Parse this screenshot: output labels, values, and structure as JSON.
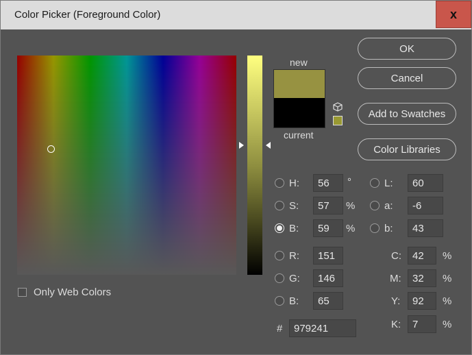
{
  "window": {
    "title": "Color Picker (Foreground Color)",
    "close_label": "x"
  },
  "swatches": {
    "new_label": "new",
    "current_label": "current",
    "new_color": "#979241",
    "current_color": "#000000",
    "websafe_color": "#999933"
  },
  "buttons": {
    "ok": "OK",
    "cancel": "Cancel",
    "add_to_swatches": "Add to Swatches",
    "color_libraries": "Color Libraries"
  },
  "only_web_colors": {
    "label": "Only Web Colors",
    "checked": false
  },
  "fields": {
    "H": {
      "label": "H:",
      "value": "56",
      "unit": "°"
    },
    "S": {
      "label": "S:",
      "value": "57",
      "unit": "%"
    },
    "Bv": {
      "label": "B:",
      "value": "59",
      "unit": "%"
    },
    "R": {
      "label": "R:",
      "value": "151"
    },
    "G": {
      "label": "G:",
      "value": "146"
    },
    "B": {
      "label": "B:",
      "value": "65"
    },
    "L": {
      "label": "L:",
      "value": "60"
    },
    "a": {
      "label": "a:",
      "value": "-6"
    },
    "b": {
      "label": "b:",
      "value": "43"
    },
    "C": {
      "label": "C:",
      "value": "42",
      "unit": "%"
    },
    "M": {
      "label": "M:",
      "value": "32",
      "unit": "%"
    },
    "Y": {
      "label": "Y:",
      "value": "92",
      "unit": "%"
    },
    "K": {
      "label": "K:",
      "value": "7",
      "unit": "%"
    },
    "hex": {
      "label": "#",
      "value": "979241"
    }
  },
  "selected_mode": "B"
}
